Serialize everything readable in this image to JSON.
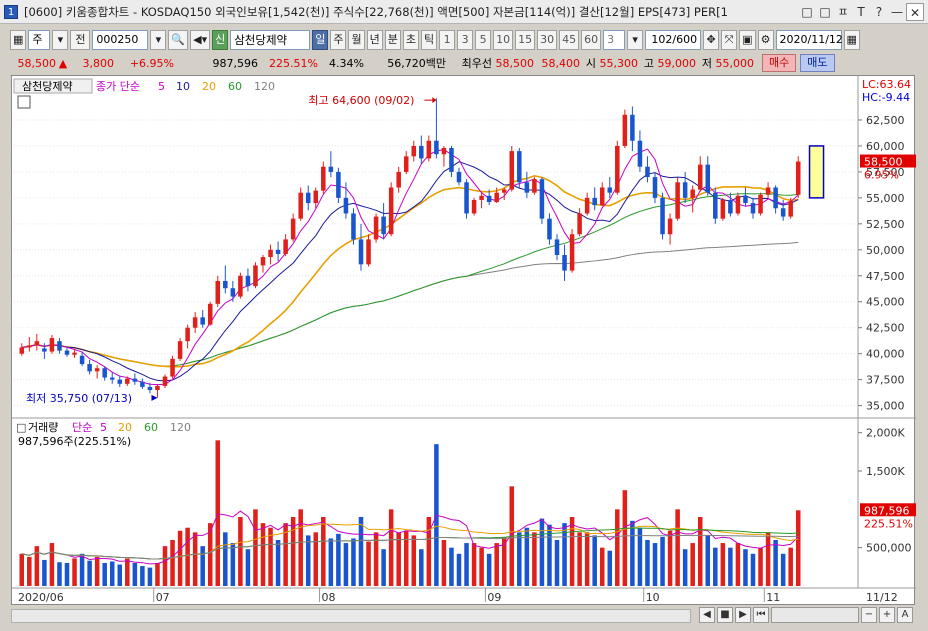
{
  "window": {
    "number": "1",
    "title": "[0600] 키움종합차트 - KOSDAQ150 외국인보유[1,542(천)] 주식수[22,768(천)] 액면[500] 자본금[114(억)] 결산[12월] EPS[473] PER[1",
    "buttons": [
      "□",
      "□",
      "ㅍ",
      "T",
      "?",
      "—",
      "✕"
    ]
  },
  "toolbar": {
    "period_select": "주",
    "prev_label": "전",
    "code": "000250",
    "new_label": "신",
    "stock_name": "삼천당제약",
    "period_buttons": [
      "일",
      "주",
      "월",
      "년",
      "분",
      "초",
      "틱"
    ],
    "active_period": "일",
    "interval_buttons": [
      "1",
      "3",
      "5",
      "10",
      "15",
      "30",
      "45",
      "60"
    ],
    "interval_value": "3",
    "count": "102/600",
    "date": "2020/11/12"
  },
  "info": {
    "price": "58,500",
    "change": "3,800",
    "change_pct": "+6.95%",
    "volume": "987,596",
    "vol_pct": "225.51%",
    "turnover": "4.34%",
    "amount": "56,720백만",
    "priority_label": "최우선",
    "ask": "58,500",
    "bid": "58,400",
    "open_label": "시",
    "open": "55,300",
    "high_label": "고",
    "high": "59,000",
    "low_label": "저",
    "low": "55,000",
    "buy_label": "매수",
    "sell_label": "매도"
  },
  "chart_panel": {
    "legend_name": "삼천당제약",
    "legend_ma_title": "종가 단순",
    "ma_periods": [
      "5",
      "10",
      "20",
      "60",
      "120"
    ],
    "ma_colors": [
      "#c800c8",
      "#0000c8",
      "#f0a000",
      "#008000",
      "#808080"
    ],
    "lc_label": "LC:63.64",
    "hc_label": "HC:-9.44",
    "high_annotation": "최고 64,600 (09/02)",
    "low_annotation": "최저 35,750 (07/13)",
    "current_price_tag": "58,500",
    "current_pct_tag": "6.95%",
    "y_ticks": [
      "62,500",
      "60,000",
      "57,500",
      "55,000",
      "52,500",
      "50,000",
      "47,500",
      "45,000",
      "42,500",
      "40,000",
      "37,500",
      "35,000"
    ]
  },
  "volume_panel": {
    "legend_name": "거래량",
    "legend_ma_title": "단순",
    "ma_periods": [
      "5",
      "20",
      "60",
      "120"
    ],
    "summary": "987,596주(225.51%)",
    "y_ticks": [
      "2,000K",
      "1,500K",
      "500,000"
    ],
    "current_tag": "987,596",
    "current_pct_tag": "225.51%"
  },
  "x_axis": {
    "labels": [
      "2020/06",
      "07",
      "08",
      "09",
      "10",
      "11"
    ],
    "end_label": "11/12"
  },
  "colors": {
    "up": "#e0201a",
    "down": "#1a55d0",
    "ma5": "#c800c8",
    "ma10": "#1a1a9a",
    "ma20": "#e8a000",
    "ma60": "#2a9a2a",
    "ma120": "#808080"
  },
  "chart_data": {
    "type": "candlestick",
    "series_note": "daily OHLC price (won) and volume (shares), June–Nov 2020",
    "ylim": [
      34000,
      65000
    ],
    "volume_ylim": [
      0,
      2100000
    ],
    "x_ticks": [
      "2020/06",
      "07",
      "08",
      "09",
      "10",
      "11"
    ],
    "candles": [
      [
        40000,
        41000,
        39800,
        40600,
        420000
      ],
      [
        40600,
        41600,
        40200,
        40800,
        380000
      ],
      [
        40800,
        41900,
        40300,
        41200,
        520000
      ],
      [
        40500,
        41000,
        39500,
        40200,
        340000
      ],
      [
        40200,
        41800,
        40000,
        41500,
        560000
      ],
      [
        41200,
        41500,
        40000,
        40300,
        310000
      ],
      [
        40300,
        40600,
        39700,
        39900,
        300000
      ],
      [
        39900,
        40400,
        39600,
        40100,
        360000
      ],
      [
        39800,
        40200,
        38800,
        39000,
        420000
      ],
      [
        39000,
        39400,
        38000,
        38300,
        330000
      ],
      [
        38300,
        38900,
        37600,
        38600,
        380000
      ],
      [
        38600,
        38800,
        37400,
        37700,
        300000
      ],
      [
        37700,
        38200,
        37100,
        37500,
        320000
      ],
      [
        37500,
        37900,
        36800,
        37100,
        280000
      ],
      [
        37100,
        37800,
        36900,
        37600,
        360000
      ],
      [
        37600,
        38100,
        37000,
        37300,
        300000
      ],
      [
        37300,
        37600,
        36600,
        36800,
        260000
      ],
      [
        36800,
        37200,
        36200,
        36500,
        240000
      ],
      [
        36500,
        37000,
        35750,
        36900,
        300000
      ],
      [
        36900,
        38000,
        36700,
        37800,
        520000
      ],
      [
        37800,
        39800,
        37600,
        39500,
        600000
      ],
      [
        39500,
        41500,
        39300,
        41200,
        720000
      ],
      [
        41200,
        42800,
        40500,
        42500,
        760000
      ],
      [
        42500,
        44000,
        42000,
        43500,
        700000
      ],
      [
        43500,
        44200,
        42500,
        42800,
        520000
      ],
      [
        42800,
        45000,
        42700,
        44800,
        820000
      ],
      [
        44800,
        47500,
        44500,
        47000,
        1900000
      ],
      [
        47000,
        48500,
        45800,
        46300,
        700000
      ],
      [
        46300,
        47000,
        45000,
        45500,
        560000
      ],
      [
        45500,
        47800,
        45300,
        47500,
        900000
      ],
      [
        47500,
        48200,
        46000,
        46500,
        480000
      ],
      [
        46500,
        48800,
        46300,
        48500,
        1000000
      ],
      [
        48500,
        49500,
        47800,
        49300,
        820000
      ],
      [
        49300,
        50500,
        48600,
        50000,
        760000
      ],
      [
        50000,
        50800,
        48900,
        49600,
        600000
      ],
      [
        49600,
        51500,
        49400,
        51000,
        820000
      ],
      [
        51000,
        53500,
        50800,
        53000,
        900000
      ],
      [
        53000,
        56000,
        52800,
        55500,
        1000000
      ],
      [
        55500,
        56200,
        53800,
        54500,
        660000
      ],
      [
        54500,
        56000,
        54000,
        55700,
        700000
      ],
      [
        55700,
        58500,
        55400,
        58000,
        900000
      ],
      [
        58000,
        59500,
        57000,
        57500,
        620000
      ],
      [
        57500,
        57900,
        54500,
        55000,
        680000
      ],
      [
        55000,
        56500,
        53000,
        53500,
        560000
      ],
      [
        53500,
        54000,
        50500,
        51000,
        620000
      ],
      [
        51000,
        52500,
        48000,
        48600,
        900000
      ],
      [
        48600,
        51500,
        48400,
        51000,
        580000
      ],
      [
        51000,
        53500,
        50700,
        53200,
        700000
      ],
      [
        53200,
        54500,
        51000,
        51500,
        480000
      ],
      [
        51500,
        56500,
        51300,
        56000,
        1000000
      ],
      [
        56000,
        58000,
        55500,
        57500,
        700000
      ],
      [
        57500,
        59500,
        57300,
        59000,
        720000
      ],
      [
        59000,
        60500,
        58500,
        60000,
        660000
      ],
      [
        60000,
        61000,
        58300,
        58800,
        480000
      ],
      [
        58800,
        61000,
        58500,
        60500,
        900000
      ],
      [
        60500,
        64600,
        58800,
        59200,
        1850000
      ],
      [
        59200,
        60000,
        58000,
        59800,
        600000
      ],
      [
        59800,
        60000,
        57000,
        57500,
        500000
      ],
      [
        57500,
        57900,
        56200,
        56500,
        420000
      ],
      [
        56500,
        56800,
        53000,
        53500,
        560000
      ],
      [
        53500,
        55000,
        53300,
        54800,
        560000
      ],
      [
        54800,
        55500,
        54000,
        55200,
        500000
      ],
      [
        55200,
        55800,
        54300,
        54600,
        420000
      ],
      [
        54600,
        56000,
        54500,
        55500,
        560000
      ],
      [
        55500,
        56000,
        54800,
        55800,
        640000
      ],
      [
        55800,
        60000,
        55600,
        59500,
        1300000
      ],
      [
        59500,
        59800,
        56000,
        56500,
        700000
      ],
      [
        56500,
        57500,
        55000,
        55500,
        760000
      ],
      [
        55500,
        57000,
        55300,
        56800,
        700000
      ],
      [
        56800,
        57000,
        52500,
        53000,
        880000
      ],
      [
        53000,
        53500,
        50500,
        51000,
        800000
      ],
      [
        51000,
        51500,
        49000,
        49500,
        600000
      ],
      [
        49500,
        50500,
        47000,
        48000,
        820000
      ],
      [
        48000,
        52000,
        47800,
        51500,
        900000
      ],
      [
        51500,
        54000,
        51300,
        53500,
        700000
      ],
      [
        53500,
        55500,
        53300,
        55000,
        700000
      ],
      [
        55000,
        56000,
        53800,
        54300,
        660000
      ],
      [
        54300,
        56500,
        54200,
        56000,
        500000
      ],
      [
        56000,
        57000,
        55000,
        55500,
        460000
      ],
      [
        55500,
        60500,
        55300,
        60000,
        1000000
      ],
      [
        60000,
        63500,
        59800,
        63000,
        1250000
      ],
      [
        63000,
        63800,
        59500,
        60500,
        850000
      ],
      [
        60500,
        61500,
        57500,
        58000,
        760000
      ],
      [
        58000,
        59000,
        56500,
        57000,
        600000
      ],
      [
        57000,
        57500,
        54500,
        55000,
        560000
      ],
      [
        55000,
        55500,
        51000,
        51500,
        640000
      ],
      [
        51500,
        53500,
        50500,
        53000,
        720000
      ],
      [
        53000,
        57000,
        52800,
        56500,
        1000000
      ],
      [
        56500,
        57500,
        54500,
        55000,
        480000
      ],
      [
        55000,
        56200,
        53600,
        55800,
        560000
      ],
      [
        55800,
        59000,
        55600,
        58200,
        900000
      ],
      [
        58200,
        59000,
        55200,
        55500,
        660000
      ],
      [
        55500,
        56000,
        52500,
        53000,
        500000
      ],
      [
        53000,
        55000,
        52800,
        54800,
        560000
      ],
      [
        54800,
        55500,
        53200,
        53500,
        500000
      ],
      [
        53500,
        55500,
        53300,
        55200,
        560000
      ],
      [
        55200,
        56000,
        54200,
        54500,
        480000
      ],
      [
        54500,
        55000,
        53000,
        53500,
        420000
      ],
      [
        53500,
        55500,
        53300,
        55300,
        500000
      ],
      [
        55300,
        56500,
        55000,
        56000,
        700000
      ],
      [
        56000,
        56200,
        53500,
        54000,
        600000
      ],
      [
        54000,
        54800,
        52800,
        53200,
        420000
      ],
      [
        53200,
        55000,
        53000,
        54700,
        500000
      ],
      [
        55300,
        59000,
        55000,
        58500,
        987596
      ]
    ]
  }
}
